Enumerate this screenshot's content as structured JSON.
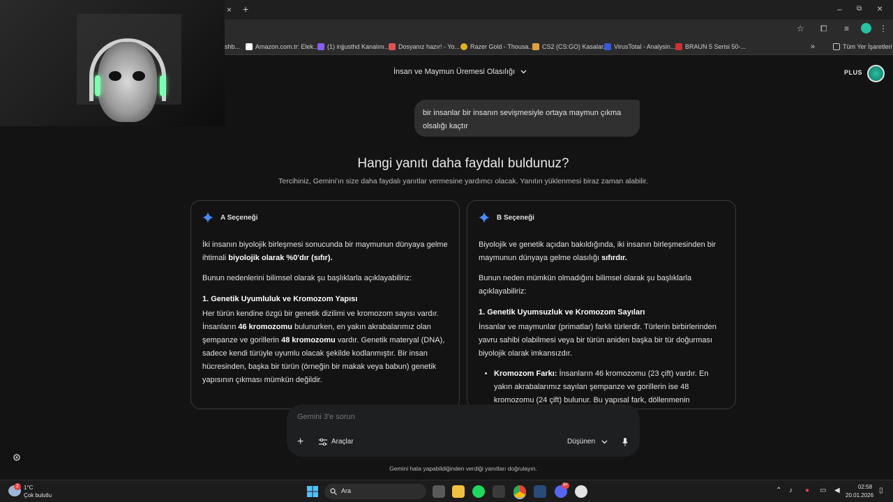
{
  "browser": {
    "tab_close": "×",
    "new_tab": "+",
    "window": {
      "minimize": "–",
      "maximize": "⧉",
      "close": "×"
    },
    "bookmarks": [
      {
        "label": "shb...",
        "color": "#5a5a5a"
      },
      {
        "label": "Amazon.com.tr: Elek...",
        "color": "#ffffff"
      },
      {
        "label": "(1) injjusthd Kanalını...",
        "color": "#8a5cf6"
      },
      {
        "label": "Dosyanız hazır! - Yo...",
        "color": "#e05252"
      },
      {
        "label": "Razer Gold - Thousa...",
        "color": "#e0b020"
      },
      {
        "label": "CS2 (CS:GO) Kasalar...",
        "color": "#e0a040"
      },
      {
        "label": "VirusTotal - Analysin...",
        "color": "#3a5ad0"
      },
      {
        "label": "BRAUN 5 Serisi 50-...",
        "color": "#d03030"
      }
    ],
    "bookmarks_more": "»",
    "all_bookmarks": "Tüm Yer İşaretleri"
  },
  "header": {
    "chat_title": "İnsan ve Maymun Üremesi Olasılığı",
    "plan_badge": "PLUS"
  },
  "user_message": "bir insanlar bir insanın sevişmesiyle ortaya maymun çıkma olsalığı kaçtır",
  "feedback": {
    "question": "Hangi yanıtı daha faydalı buldunuz?",
    "subtitle": "Tercihiniz, Gemini'ın size daha faydalı yanıtlar vermesine yardımcı olacak. Yanıtın yüklenmesi biraz zaman alabilir."
  },
  "option_a": {
    "label": "A Seçeneği",
    "p1_start": "İki insanın biyolojik birleşmesi sonucunda bir maymunun dünyaya gelme ihtimali ",
    "p1_bold": "biyolojik olarak %0'dır (sıfır).",
    "p2": "Bunun nedenlerini bilimsel olarak şu başlıklarla açıklayabiliriz:",
    "heading1": "1. Genetik Uyumluluk ve Kromozom Yapısı",
    "p3_a": "Her türün kendine özgü bir genetik dizilimi ve kromozom sayısı vardır. İnsanların ",
    "p3_b1": "46 kromozomu",
    "p3_c": " bulunurken, en yakın akrabalarımız olan şempanze ve gorillerin ",
    "p3_b2": "48 kromozomu",
    "p3_d": " vardır. Genetik materyal (DNA), sadece kendi türüyle uyumlu olacak şekilde kodlanmıştır. Bir insan hücresinden, başka bir türün (örneğin bir makak veya babun) genetik yapısının çıkması mümkün değildir."
  },
  "option_b": {
    "label": "B Seçeneği",
    "p1_start": "Biyolojik ve genetik açıdan bakıldığında, iki insanın birleşmesinden bir maymunun dünyaya gelme olasılığı ",
    "p1_bold": "sıfırdır.",
    "p2": "Bunun neden mümkün olmadığını bilimsel olarak şu başlıklarla açıklayabiliriz:",
    "heading1": "1. Genetik Uyumsuzluk ve Kromozom Sayıları",
    "p3": "İnsanlar ve maymunlar (primatlar) farklı türlerdir. Türlerin birbirlerinden yavru sahibi olabilmesi veya bir türün aniden başka bir tür doğurması biyolojik olarak imkansızdır.",
    "bullet_bold": "Kromozom Farkı:",
    "bullet_text": " İnsanların 46 kromozomu (23 çift) vardır. En yakın akrabalarımız sayılan şempanze ve gorillerin ise 48 kromozomu (24 çift) bulunur. Bu yapısal fark, döllenmenin gerçekleşmesini ve sağlıklı"
  },
  "composer": {
    "placeholder": "Gemini 3'e sorun",
    "add": "+",
    "tools": "Araçlar",
    "mode": "Düşünen"
  },
  "disclaimer": "Gemini hata yapabildiğinden verdiği yanıtları doğrulayın.",
  "taskbar": {
    "weather_temp": "1°C",
    "weather_desc": "Çok bulutlu",
    "weather_badge": "2",
    "search": "Ara",
    "time": "02:58",
    "date": "20.01.2026",
    "discord_badge": "9+"
  }
}
